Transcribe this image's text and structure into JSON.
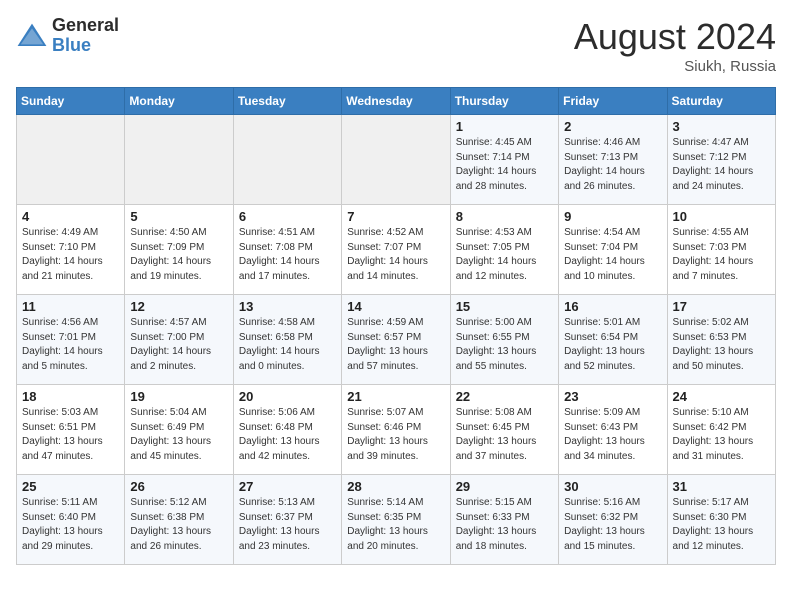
{
  "header": {
    "logo_line1": "General",
    "logo_line2": "Blue",
    "month_year": "August 2024",
    "location": "Siukh, Russia"
  },
  "days_of_week": [
    "Sunday",
    "Monday",
    "Tuesday",
    "Wednesday",
    "Thursday",
    "Friday",
    "Saturday"
  ],
  "weeks": [
    [
      {
        "day": "",
        "empty": true
      },
      {
        "day": "",
        "empty": true
      },
      {
        "day": "",
        "empty": true
      },
      {
        "day": "",
        "empty": true
      },
      {
        "day": "1",
        "sunrise": "4:45 AM",
        "sunset": "7:14 PM",
        "daylight": "14 hours and 28 minutes."
      },
      {
        "day": "2",
        "sunrise": "4:46 AM",
        "sunset": "7:13 PM",
        "daylight": "14 hours and 26 minutes."
      },
      {
        "day": "3",
        "sunrise": "4:47 AM",
        "sunset": "7:12 PM",
        "daylight": "14 hours and 24 minutes."
      }
    ],
    [
      {
        "day": "4",
        "sunrise": "4:49 AM",
        "sunset": "7:10 PM",
        "daylight": "14 hours and 21 minutes."
      },
      {
        "day": "5",
        "sunrise": "4:50 AM",
        "sunset": "7:09 PM",
        "daylight": "14 hours and 19 minutes."
      },
      {
        "day": "6",
        "sunrise": "4:51 AM",
        "sunset": "7:08 PM",
        "daylight": "14 hours and 17 minutes."
      },
      {
        "day": "7",
        "sunrise": "4:52 AM",
        "sunset": "7:07 PM",
        "daylight": "14 hours and 14 minutes."
      },
      {
        "day": "8",
        "sunrise": "4:53 AM",
        "sunset": "7:05 PM",
        "daylight": "14 hours and 12 minutes."
      },
      {
        "day": "9",
        "sunrise": "4:54 AM",
        "sunset": "7:04 PM",
        "daylight": "14 hours and 10 minutes."
      },
      {
        "day": "10",
        "sunrise": "4:55 AM",
        "sunset": "7:03 PM",
        "daylight": "14 hours and 7 minutes."
      }
    ],
    [
      {
        "day": "11",
        "sunrise": "4:56 AM",
        "sunset": "7:01 PM",
        "daylight": "14 hours and 5 minutes."
      },
      {
        "day": "12",
        "sunrise": "4:57 AM",
        "sunset": "7:00 PM",
        "daylight": "14 hours and 2 minutes."
      },
      {
        "day": "13",
        "sunrise": "4:58 AM",
        "sunset": "6:58 PM",
        "daylight": "14 hours and 0 minutes."
      },
      {
        "day": "14",
        "sunrise": "4:59 AM",
        "sunset": "6:57 PM",
        "daylight": "13 hours and 57 minutes."
      },
      {
        "day": "15",
        "sunrise": "5:00 AM",
        "sunset": "6:55 PM",
        "daylight": "13 hours and 55 minutes."
      },
      {
        "day": "16",
        "sunrise": "5:01 AM",
        "sunset": "6:54 PM",
        "daylight": "13 hours and 52 minutes."
      },
      {
        "day": "17",
        "sunrise": "5:02 AM",
        "sunset": "6:53 PM",
        "daylight": "13 hours and 50 minutes."
      }
    ],
    [
      {
        "day": "18",
        "sunrise": "5:03 AM",
        "sunset": "6:51 PM",
        "daylight": "13 hours and 47 minutes."
      },
      {
        "day": "19",
        "sunrise": "5:04 AM",
        "sunset": "6:49 PM",
        "daylight": "13 hours and 45 minutes."
      },
      {
        "day": "20",
        "sunrise": "5:06 AM",
        "sunset": "6:48 PM",
        "daylight": "13 hours and 42 minutes."
      },
      {
        "day": "21",
        "sunrise": "5:07 AM",
        "sunset": "6:46 PM",
        "daylight": "13 hours and 39 minutes."
      },
      {
        "day": "22",
        "sunrise": "5:08 AM",
        "sunset": "6:45 PM",
        "daylight": "13 hours and 37 minutes."
      },
      {
        "day": "23",
        "sunrise": "5:09 AM",
        "sunset": "6:43 PM",
        "daylight": "13 hours and 34 minutes."
      },
      {
        "day": "24",
        "sunrise": "5:10 AM",
        "sunset": "6:42 PM",
        "daylight": "13 hours and 31 minutes."
      }
    ],
    [
      {
        "day": "25",
        "sunrise": "5:11 AM",
        "sunset": "6:40 PM",
        "daylight": "13 hours and 29 minutes."
      },
      {
        "day": "26",
        "sunrise": "5:12 AM",
        "sunset": "6:38 PM",
        "daylight": "13 hours and 26 minutes."
      },
      {
        "day": "27",
        "sunrise": "5:13 AM",
        "sunset": "6:37 PM",
        "daylight": "13 hours and 23 minutes."
      },
      {
        "day": "28",
        "sunrise": "5:14 AM",
        "sunset": "6:35 PM",
        "daylight": "13 hours and 20 minutes."
      },
      {
        "day": "29",
        "sunrise": "5:15 AM",
        "sunset": "6:33 PM",
        "daylight": "13 hours and 18 minutes."
      },
      {
        "day": "30",
        "sunrise": "5:16 AM",
        "sunset": "6:32 PM",
        "daylight": "13 hours and 15 minutes."
      },
      {
        "day": "31",
        "sunrise": "5:17 AM",
        "sunset": "6:30 PM",
        "daylight": "13 hours and 12 minutes."
      }
    ]
  ]
}
